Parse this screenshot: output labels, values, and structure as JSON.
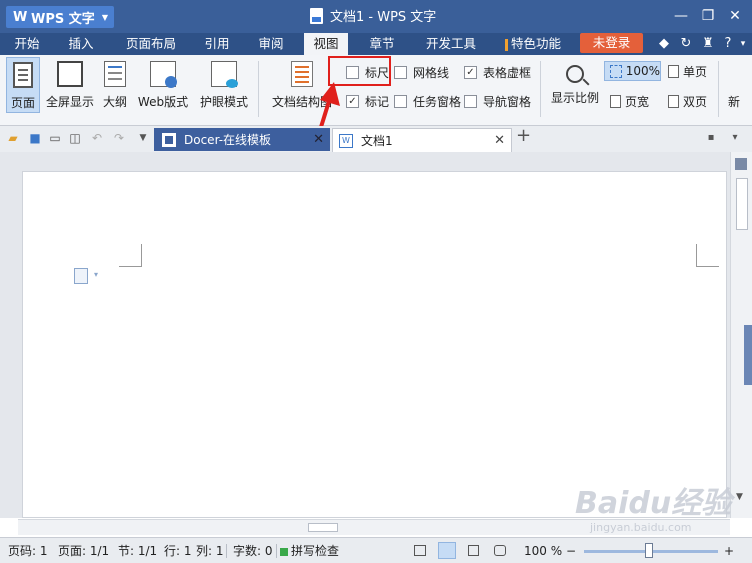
{
  "titlebar": {
    "app_label": "WPS 文字",
    "document_title": "文档1 - WPS 文字",
    "window_controls": [
      "minimize-icon",
      "restore-icon",
      "close-icon"
    ]
  },
  "menubar": {
    "items": [
      "开始",
      "插入",
      "页面布局",
      "引用",
      "审阅",
      "视图",
      "章节",
      "开发工具",
      "特色功能"
    ],
    "active": "视图",
    "login_label": "未登录",
    "right_icons": [
      "skin-icon",
      "history-icon",
      "shirt-icon",
      "help-icon",
      "collapse-icon"
    ],
    "help_label": "?",
    "colors": {
      "titlebar": "#3a5f99",
      "menubar": "#2e5187",
      "login": "#e4603a"
    }
  },
  "ribbon": {
    "view_buttons": [
      "页面",
      "全屏显示",
      "大纲",
      "Web版式",
      "护眼模式",
      "文档结构图"
    ],
    "checkboxes": [
      {
        "label": "标尺",
        "checked": false
      },
      {
        "label": "网格线",
        "checked": false
      },
      {
        "label": "表格虚框",
        "checked": true
      },
      {
        "label": "标记",
        "checked": true
      },
      {
        "label": "任务窗格",
        "checked": false
      },
      {
        "label": "导航窗格",
        "checked": false
      }
    ],
    "zoom_button": "显示比例",
    "zoom_100": "100%",
    "single_page": "单页",
    "page_width": "页宽",
    "two_page": "双页",
    "new_label": "新",
    "check_glyph": "✓"
  },
  "tabbar": {
    "tabs": [
      {
        "label": "Docer-在线模板",
        "close": "✕"
      },
      {
        "label": "文档1",
        "close": "✕"
      }
    ],
    "new_tab": "+"
  },
  "statusbar": {
    "page_code": "页码: 1",
    "page_count": "页面: 1/1",
    "section": "节: 1/1",
    "line": "行: 1",
    "column": "列: 1",
    "word_count": "字数: 0",
    "spell_check": "拼写检查",
    "zoom_text": "100 %",
    "zoom_minus": "−",
    "zoom_plus": "+"
  },
  "watermark": {
    "text": "Baidu经验",
    "sub": "jingyan.baidu.com"
  }
}
